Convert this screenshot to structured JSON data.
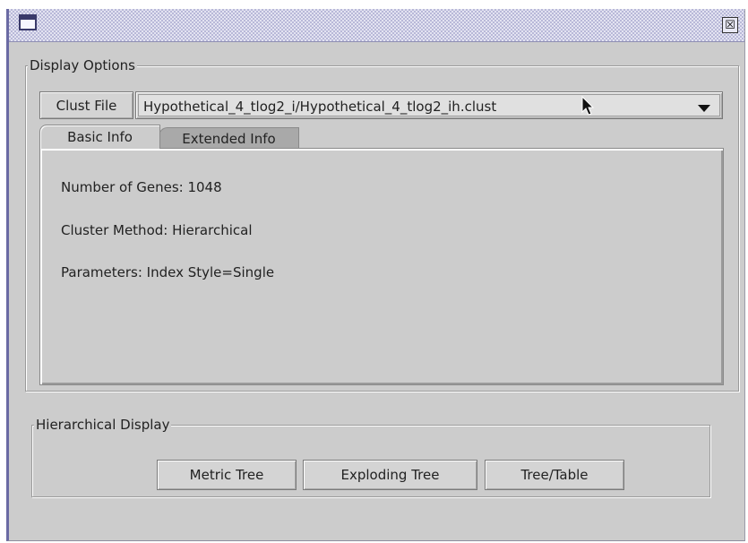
{
  "window": {
    "close_glyph": "☒"
  },
  "display_options": {
    "legend": "Display Options",
    "clust_file_label": "Clust File",
    "clust_file_value": "Hypothetical_4_tlog2_i/Hypothetical_4_tlog2_ih.clust",
    "tabs": [
      {
        "label": "Basic Info",
        "selected": true
      },
      {
        "label": "Extended Info",
        "selected": false
      }
    ],
    "basic_info": {
      "genes": "Number of Genes:  1048",
      "method": "Cluster Method:  Hierarchical",
      "parameters": "Parameters:  Index Style=Single"
    }
  },
  "hierarchical_display": {
    "legend": "Hierarchical Display",
    "buttons": [
      "Metric Tree",
      "Exploding Tree",
      "Tree/Table"
    ]
  },
  "icons": {
    "app": "window-app-icon",
    "close": "close-icon",
    "dropdown": "chevron-down-icon",
    "cursor": "mouse-pointer-icon"
  },
  "colors": {
    "window_bg": "#cccccc",
    "titlebar_stipple": "#b8b8d8",
    "frame_border": "#6a6aa3",
    "tab_inactive": "#a9a9a9"
  }
}
